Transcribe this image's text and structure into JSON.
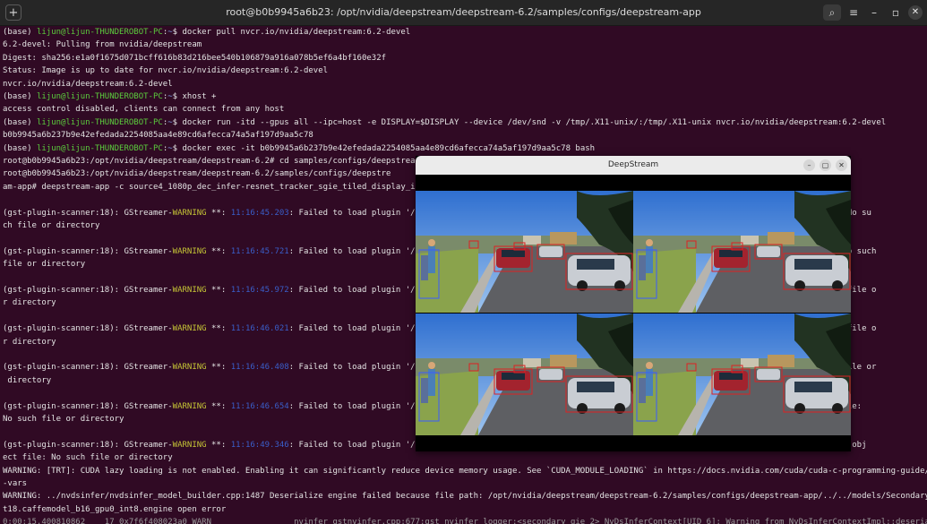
{
  "window": {
    "title": "root@b0b9945a6b23: /opt/nvidia/deepstream/deepstream-6.2/samples/configs/deepstream-app",
    "new_tab_glyph": "+",
    "search_glyph": "⌕",
    "menu_glyph": "≡",
    "minimize_glyph": "–",
    "maximize_glyph": "▫",
    "close_glyph": "✕"
  },
  "terminal": {
    "lines": [
      {
        "parts": [
          {
            "t": "(base) "
          },
          {
            "t": "lijun@lijun-THUNDEROBOT-PC",
            "c": "g"
          },
          {
            "t": ":"
          },
          {
            "t": "~",
            "c": "b"
          },
          {
            "t": "$ docker pull nvcr.io/nvidia/deepstream:6.2-devel"
          }
        ]
      },
      {
        "parts": [
          {
            "t": "6.2-devel: Pulling from nvidia/deepstream"
          }
        ]
      },
      {
        "parts": [
          {
            "t": "Digest: sha256:e1a0f1675d071bcff616b83d216bee540b106879a916a078b5ef6a4bf160e32f"
          }
        ]
      },
      {
        "parts": [
          {
            "t": "Status: Image is up to date for nvcr.io/nvidia/deepstream:6.2-devel"
          }
        ]
      },
      {
        "parts": [
          {
            "t": "nvcr.io/nvidia/deepstream:6.2-devel"
          }
        ]
      },
      {
        "parts": [
          {
            "t": "(base) "
          },
          {
            "t": "lijun@lijun-THUNDEROBOT-PC",
            "c": "g"
          },
          {
            "t": ":"
          },
          {
            "t": "~",
            "c": "b"
          },
          {
            "t": "$ xhost +"
          }
        ]
      },
      {
        "parts": [
          {
            "t": "access control disabled, clients can connect from any host"
          }
        ]
      },
      {
        "parts": [
          {
            "t": "(base) "
          },
          {
            "t": "lijun@lijun-THUNDEROBOT-PC",
            "c": "g"
          },
          {
            "t": ":"
          },
          {
            "t": "~",
            "c": "b"
          },
          {
            "t": "$ docker run -itd --gpus all --ipc=host -e DISPLAY=$DISPLAY --device /dev/snd -v /tmp/.X11-unix/:/tmp/.X11-unix nvcr.io/nvidia/deepstream:6.2-devel"
          }
        ]
      },
      {
        "parts": [
          {
            "t": "b0b9945a6b237b9e42efedada2254085aa4e89cd6afecca74a5af197d9aa5c78"
          }
        ]
      },
      {
        "parts": [
          {
            "t": "(base) "
          },
          {
            "t": "lijun@lijun-THUNDEROBOT-PC",
            "c": "g"
          },
          {
            "t": ":"
          },
          {
            "t": "~",
            "c": "b"
          },
          {
            "t": "$ docker exec -it b0b9945a6b237b9e42efedada2254085aa4e89cd6afecca74a5af197d9aa5c78 bash"
          }
        ]
      },
      {
        "parts": [
          {
            "t": "root@b0b9945a6b23:/opt/nvidia/deepstream/deepstream-6.2# cd samples/configs/deepstream-app"
          }
        ]
      },
      {
        "parts": [
          {
            "t": "root@b0b9945a6b23:/opt/nvidia/deepstream/deepstream-6.2/samples/configs/deepstre"
          }
        ]
      },
      {
        "parts": [
          {
            "t": "am-app# deepstream-app -c source4_1080p_dec_infer-resnet_tracker_sgie_tiled_display_int8.txt"
          }
        ]
      },
      {
        "parts": []
      },
      {
        "parts": [
          {
            "t": "(gst-plugin-scanner:18): GStreamer-"
          },
          {
            "t": "WARNING",
            "c": "w"
          },
          {
            "t": " **: "
          },
          {
            "t": "11:16:45.203",
            "c": "t"
          },
          {
            "t": ": Failed to load plugin '/usr/lib/"
          },
          {
            "t": "                                                                       ect file: No su"
          }
        ]
      },
      {
        "parts": [
          {
            "t": "ch file or directory"
          }
        ]
      },
      {
        "parts": []
      },
      {
        "parts": [
          {
            "t": "(gst-plugin-scanner:18): GStreamer-"
          },
          {
            "t": "WARNING",
            "c": "w"
          },
          {
            "t": " **: "
          },
          {
            "t": "11:16:45.721",
            "c": "t"
          },
          {
            "t": ": Failed to load plugin '/usr/lib/"
          },
          {
            "t": "                                                                          file: No such"
          }
        ]
      },
      {
        "parts": [
          {
            "t": "file or directory"
          }
        ]
      },
      {
        "parts": []
      },
      {
        "parts": [
          {
            "t": "(gst-plugin-scanner:18): GStreamer-"
          },
          {
            "t": "WARNING",
            "c": "w"
          },
          {
            "t": " **: "
          },
          {
            "t": "11:16:45.972",
            "c": "t"
          },
          {
            "t": ": Failed to load plugin '/usr/lib/"
          },
          {
            "t": "                                                                         No such file o"
          }
        ]
      },
      {
        "parts": [
          {
            "t": "r directory"
          }
        ]
      },
      {
        "parts": []
      },
      {
        "parts": [
          {
            "t": "(gst-plugin-scanner:18): GStreamer-"
          },
          {
            "t": "WARNING",
            "c": "w"
          },
          {
            "t": " **: "
          },
          {
            "t": "11:16:46.021",
            "c": "t"
          },
          {
            "t": ": Failed to load plugin '/usr/lib/"
          },
          {
            "t": "                                                                         No such file o"
          }
        ]
      },
      {
        "parts": [
          {
            "t": "r directory"
          }
        ]
      },
      {
        "parts": []
      },
      {
        "parts": [
          {
            "t": "(gst-plugin-scanner:18): GStreamer-"
          },
          {
            "t": "WARNING",
            "c": "w"
          },
          {
            "t": " **: "
          },
          {
            "t": "11:16:46.408",
            "c": "t"
          },
          {
            "t": ": Failed to load plugin '/usr/lib/"
          },
          {
            "t": "                                                                        No such file or"
          }
        ]
      },
      {
        "parts": [
          {
            "t": " directory"
          }
        ]
      },
      {
        "parts": []
      },
      {
        "parts": [
          {
            "t": "(gst-plugin-scanner:18): GStreamer-"
          },
          {
            "t": "WARNING",
            "c": "w"
          },
          {
            "t": " **: "
          },
          {
            "t": "11:16:46.654",
            "c": "t"
          },
          {
            "t": ": Failed to load plugin '/usr/lib/"
          },
          {
            "t": "                                                                      d object file:"
          }
        ]
      },
      {
        "parts": [
          {
            "t": "No such file or directory"
          }
        ]
      },
      {
        "parts": []
      },
      {
        "parts": [
          {
            "t": "(gst-plugin-scanner:18): GStreamer-"
          },
          {
            "t": "WARNING",
            "c": "w"
          },
          {
            "t": " **: "
          },
          {
            "t": "11:16:49.346",
            "c": "t"
          },
          {
            "t": ": Failed to load plugin '/usr/lib/"
          },
          {
            "t": "                                                                      open shared obj"
          }
        ]
      },
      {
        "parts": [
          {
            "t": "ect file: No such file or directory"
          }
        ]
      },
      {
        "parts": [
          {
            "t": "WARNING: [TRT]: CUDA lazy loading is not enabled. Enabling it can significantly reduce device memory usage. See `CUDA_MODULE_LOADING` in https://docs.nvidia.com/cuda/cuda-c-programming-guide/index.html#env"
          }
        ]
      },
      {
        "parts": [
          {
            "t": "-vars"
          }
        ]
      },
      {
        "parts": [
          {
            "t": "WARNING: ../nvdsinfer/nvdsinfer_model_builder.cpp:1487 Deserialize engine failed because file path: /opt/nvidia/deepstream/deepstream-6.2/samples/configs/deepstream-app/../../models/Secondary_CarMake/resne"
          }
        ]
      },
      {
        "parts": [
          {
            "t": "t18.caffemodel_b16_gpu0_int8.engine open error"
          }
        ]
      },
      {
        "parts": [
          {
            "t": "0:00:15.400810862    17 0x7f6f408023a0 WARN                 nvinfer gstnvinfer.cpp:677:gst_nvinfer_logger:<secondary_gie_2> NvDsInferContext[UID 6]: Warning from NvDsInferContextImpl::deserializeEngineAnd",
            "c": "dim"
          }
        ]
      }
    ]
  },
  "deepstream_window": {
    "title": "DeepStream",
    "minimize_glyph": "–",
    "maximize_glyph": "▢",
    "close_glyph": "✕",
    "tile_count": 4
  }
}
